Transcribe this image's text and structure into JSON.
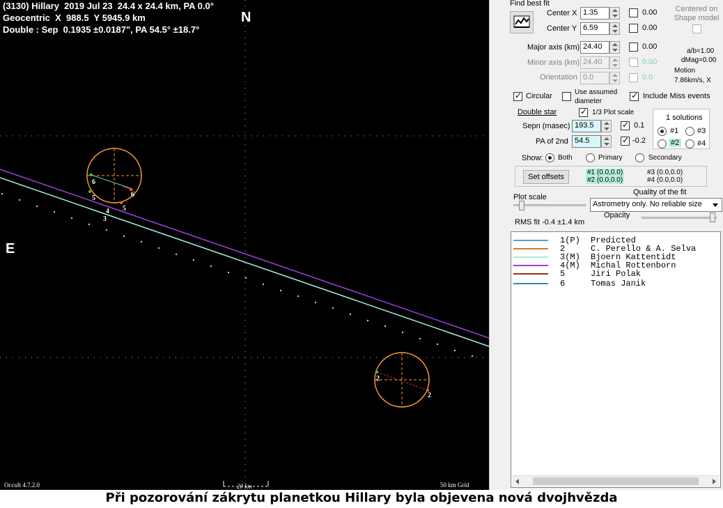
{
  "plot": {
    "header": {
      "line1": "(3130) Hillary  2019 Jul 23  24.4 x 24.4 km, PA 0.0°",
      "line2": "Geocentric  X  988.5  Y 5945.9 km",
      "line3": "Double : Sep  0.1935 ±0.0187\", PA 54.5° ±18.7°"
    },
    "north": "N",
    "east": "E",
    "version": "Occult 4.7.2.0",
    "scale_label": "20 km",
    "grid_label": "50 km Grid",
    "marker_labels": [
      "6",
      "6",
      "5",
      "5",
      "4",
      "3",
      "2",
      "2"
    ],
    "colors": {
      "predicted": "#5aa0c8",
      "perello": "#e07820",
      "kattentidt": "#a8f0d8",
      "rottenborn": "#a040e0",
      "polak": "#8b3a10",
      "janik": "#3090a0",
      "ellipse": "#ff9a30"
    }
  },
  "panel": {
    "find_best_fit": "Find best fit",
    "center_x_label": "Center X",
    "center_x": "1.35",
    "center_x_zero": "0.00",
    "center_y_label": "Center Y",
    "center_y": "6.59",
    "center_y_zero": "0.00",
    "centered_on_shape": "Centered on Shape model",
    "major_label": "Major axis (km)",
    "major": "24.40",
    "major_zero": "0.00",
    "minor_label": "Minor axis (km)",
    "minor": "24.40",
    "minor_zero": "0.00",
    "orient_label": "Orientation",
    "orient": "0.0",
    "orient_zero": "0.0",
    "ab": "a/b=1.00",
    "dmag": "dMag=0.00",
    "motion_label": "Motion",
    "motion": "7.86km/s, X",
    "circular": "Circular",
    "use_assumed": "Use assumed diameter",
    "include_miss": "Include Miss events",
    "double_star": "Double star",
    "plot_scale_third": "1/3 Plot scale",
    "sepn_label": "Sepn (masec)",
    "sepn": "193.5",
    "sepn_step": "0.1",
    "pa2_label": "PA of 2nd",
    "pa2": "54.5",
    "pa2_step": "-0.2",
    "solutions_title": "1 solutions",
    "sol1": "#1",
    "sol2": "#2",
    "sol3": "#3",
    "sol4": "#4",
    "show_label": "Show:",
    "show_both": "Both",
    "show_primary": "Primary",
    "show_secondary": "Secondary",
    "set_offsets": "Set offsets",
    "off1": "#1 (0.0,0.0)",
    "off2": "#2 (0.0,0.0)",
    "off3": "#3 (0.0,0.0)",
    "off4": "#4 (0.0,0.0)",
    "plot_scale": "Plot scale",
    "quality_label": "Quality of the fit",
    "quality_value": "Astrometry only. No reliable size",
    "opacity": "Opacity",
    "rms": "RMS fit  -0.4 ±1.4 km"
  },
  "legend": [
    {
      "num": "1(P)",
      "name": "Predicted",
      "color": "#5aa0c8"
    },
    {
      "num": "2",
      "name": "C. Perello & A. Selva",
      "color": "#e07820"
    },
    {
      "num": "3(M)",
      "name": "Bjoern Kattentidt",
      "color": "#a8f0d8"
    },
    {
      "num": "4(M)",
      "name": "Michal Rottenborn",
      "color": "#a040e0"
    },
    {
      "num": "5",
      "name": "Jiri Polak",
      "color": "#8b3a10"
    },
    {
      "num": "6",
      "name": "Tomas Janik",
      "color": "#3090a0"
    }
  ],
  "caption": "Při pozorování zákrytu planetkou Hillary byla objevena nová dvojhvězda"
}
